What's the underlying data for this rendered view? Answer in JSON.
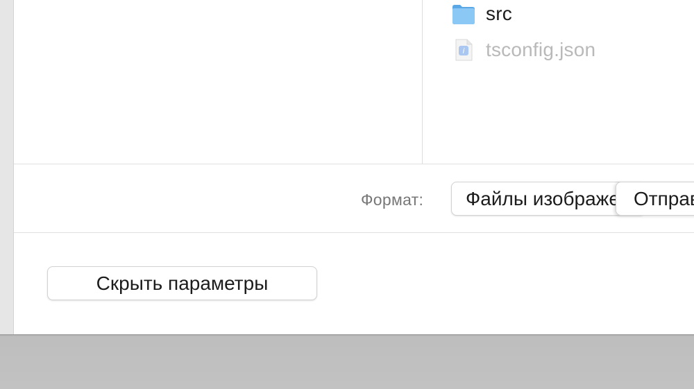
{
  "file_list": {
    "items": [
      {
        "name": "src",
        "icon": "folder-icon",
        "enabled": true
      },
      {
        "name": "tsconfig.json",
        "icon": "json-file-icon",
        "enabled": false
      }
    ]
  },
  "format": {
    "label": "Формат:",
    "selected": "Файлы изображений"
  },
  "actions": {
    "primary_label": "Отправить",
    "hide_options_label": "Скрыть параметры"
  },
  "colors": {
    "folder_blue": "#6cb4ee",
    "disabled_text": "#b9b9b9",
    "label_gray": "#777777"
  }
}
